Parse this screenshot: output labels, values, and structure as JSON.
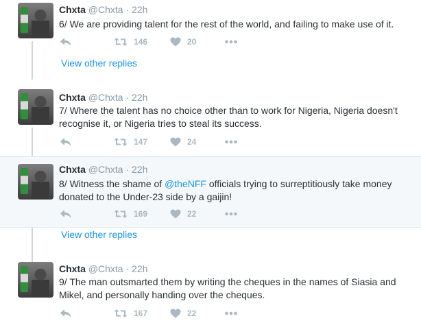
{
  "tweets": [
    {
      "name": "Chxta",
      "handle": "@Chxta",
      "separator": "·",
      "time": "22h",
      "text_before": "6/ We are providing talent for the rest of the world, and failing to make use of it.",
      "mention": "",
      "text_after": "",
      "retweets": "146",
      "likes": "20"
    },
    {
      "name": "Chxta",
      "handle": "@Chxta",
      "separator": "·",
      "time": "22h",
      "text_before": "7/ Where the talent has no choice other than to work for Nigeria, Nigeria doesn't recognise it, or Nigeria tries to steal its success.",
      "mention": "",
      "text_after": "",
      "retweets": "147",
      "likes": "24"
    },
    {
      "name": "Chxta",
      "handle": "@Chxta",
      "separator": "·",
      "time": "22h",
      "text_before": "8/ Witness the shame of ",
      "mention": "@theNFF",
      "text_after": " officials trying to surreptitiously take money donated to the Under-23 side by a gaijin!",
      "retweets": "169",
      "likes": "22"
    },
    {
      "name": "Chxta",
      "handle": "@Chxta",
      "separator": "·",
      "time": "22h",
      "text_before": "9/ The man outsmarted them by writing the cheques in the names of Siasia and Mikel, and personally handing over the cheques.",
      "mention": "",
      "text_after": "",
      "retweets": "167",
      "likes": "22"
    }
  ],
  "view_other_replies": "View other replies",
  "icons": {
    "reply": "reply-arrow-icon",
    "retweet": "retweet-icon",
    "like": "heart-icon",
    "more": "more-dots-icon",
    "avatar": "avatar"
  },
  "colors": {
    "link": "#1b95e0",
    "muted": "#8899a6",
    "action": "#aab8c2",
    "highlight_bg": "#f5f8fa",
    "thread_line": "#ccd6dd"
  }
}
